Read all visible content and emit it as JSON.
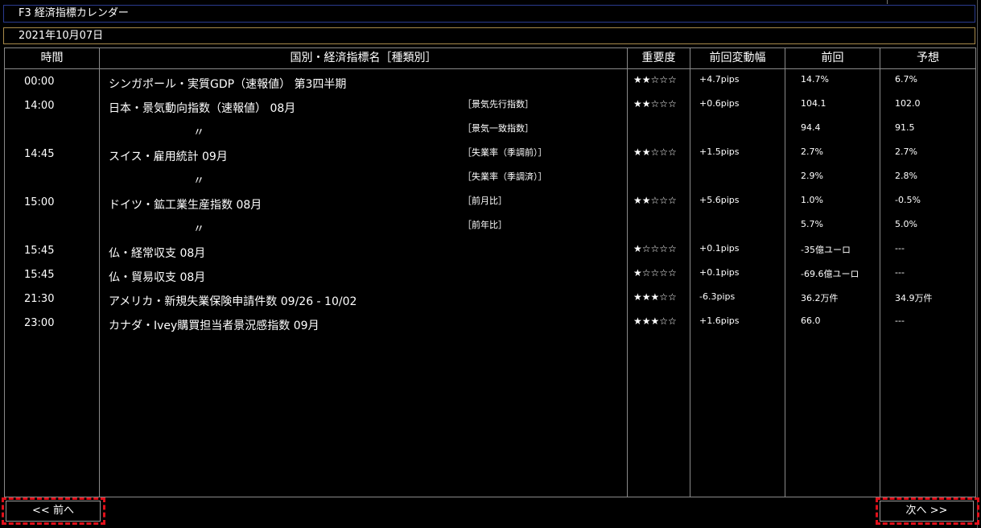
{
  "window": {
    "title": "F3 経済指標カレンダー"
  },
  "date": "2021年10月07日",
  "headers": {
    "time": "時間",
    "name": "国別・経済指標名［種類別］",
    "importance": "重要度",
    "prev_change": "前回変動幅",
    "previous": "前回",
    "forecast": "予想"
  },
  "rows": [
    {
      "time": "00:00",
      "name": "シンガポール・実質GDP（速報値） 第3四半期",
      "kind": "",
      "stars": "★★☆☆☆",
      "change": "+4.7pips",
      "previous": "14.7%",
      "forecast": "6.7%"
    },
    {
      "time": "14:00",
      "name": "日本・景気動向指数（速報値） 08月",
      "kind": "［景気先行指数］",
      "stars": "★★☆☆☆",
      "change": "+0.6pips",
      "previous": "104.1",
      "forecast": "102.0"
    },
    {
      "time": "",
      "name": "〃",
      "kind": "［景気一致指数］",
      "stars": "",
      "change": "",
      "previous": "94.4",
      "forecast": "91.5"
    },
    {
      "time": "14:45",
      "name": "スイス・雇用統計 09月",
      "kind": "［失業率（季調前）］",
      "stars": "★★☆☆☆",
      "change": "+1.5pips",
      "previous": "2.7%",
      "forecast": "2.7%"
    },
    {
      "time": "",
      "name": "〃",
      "kind": "［失業率（季調済）］",
      "stars": "",
      "change": "",
      "previous": "2.9%",
      "forecast": "2.8%"
    },
    {
      "time": "15:00",
      "name": "ドイツ・鉱工業生産指数 08月",
      "kind": "［前月比］",
      "stars": "★★☆☆☆",
      "change": "+5.6pips",
      "previous": "1.0%",
      "forecast": "-0.5%"
    },
    {
      "time": "",
      "name": "〃",
      "kind": "［前年比］",
      "stars": "",
      "change": "",
      "previous": "5.7%",
      "forecast": "5.0%"
    },
    {
      "time": "15:45",
      "name": "仏・経常収支 08月",
      "kind": "",
      "stars": "★☆☆☆☆",
      "change": "+0.1pips",
      "previous": "-35億ユーロ",
      "forecast": "---"
    },
    {
      "time": "15:45",
      "name": "仏・貿易収支 08月",
      "kind": "",
      "stars": "★☆☆☆☆",
      "change": "+0.1pips",
      "previous": "-69.6億ユーロ",
      "forecast": "---"
    },
    {
      "time": "21:30",
      "name": "アメリカ・新規失業保険申請件数 09/26 - 10/02",
      "kind": "",
      "stars": "★★★☆☆",
      "change": "-6.3pips",
      "previous": "36.2万件",
      "forecast": "34.9万件"
    },
    {
      "time": "23:00",
      "name": "カナダ・Ivey購買担当者景況感指数 09月",
      "kind": "",
      "stars": "★★★☆☆",
      "change": "+1.6pips",
      "previous": "66.0",
      "forecast": "---"
    }
  ],
  "nav": {
    "prev_label": "<<  前へ",
    "next_label": "次へ >>"
  },
  "colors": {
    "highlight": "#e0101a",
    "title_border": "#2a3b8f",
    "date_border": "#a88a4a"
  }
}
